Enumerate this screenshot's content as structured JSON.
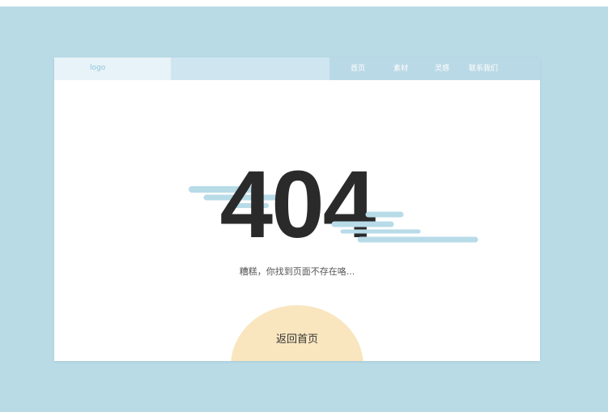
{
  "header": {
    "logo": "logo",
    "nav": [
      {
        "label": "首页"
      },
      {
        "label": "素材"
      },
      {
        "label": "灵感"
      },
      {
        "label": "联系我们"
      }
    ]
  },
  "error": {
    "code": "404",
    "message": "糟糕，你找到页面不存在咯..."
  },
  "actions": {
    "home_label": "返回首页"
  },
  "colors": {
    "background": "#b9dbe6",
    "header": "#bad9e6",
    "accent_cloud": "#b8dbe8",
    "button": "#f9e6bf",
    "text_dark": "#2a2a2a"
  }
}
